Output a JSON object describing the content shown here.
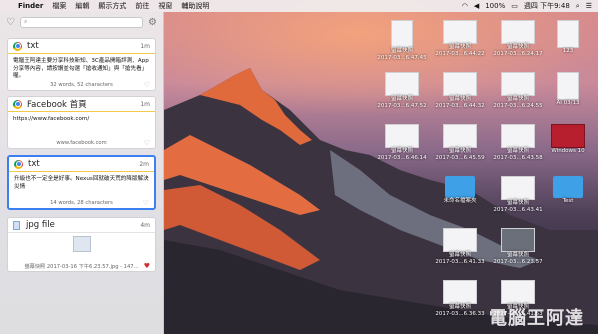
{
  "menubar": {
    "apple": "",
    "items": [
      "Finder",
      "檔案",
      "編輯",
      "顯示方式",
      "前往",
      "視窗",
      "輔助說明"
    ],
    "status": {
      "battery": "100%",
      "clock": "週四 下午9:48"
    }
  },
  "panel": {
    "search_placeholder": "",
    "clips": [
      {
        "title": "txt",
        "time": "1m",
        "body": "電腦王阿達主要分享科技新知、3C產品開箱評測、App分享等內容，請按讚並勾選「搶收通知」與「搶先看」喔。",
        "foot": "32 words, 52 characters"
      },
      {
        "title": "Facebook 首頁",
        "time": "1m",
        "body": "https://www.facebook.com/",
        "foot": "www.facebook.com"
      },
      {
        "title": "txt",
        "time": "2m",
        "body": "升級也不一定全是好事。Nexus回就破天荒的降版解決災情",
        "foot": "14 words, 28 characters"
      },
      {
        "title": "jpg file",
        "time": "4m",
        "body": "",
        "foot": "螢幕快照 2017-03-16 下午6.23.57.jpg - 147..."
      }
    ]
  },
  "desktop": {
    "icons": [
      {
        "label": "螢幕快照\n2017-03...6.47.45"
      },
      {
        "label": "螢幕快照\n2017-03...6.44.22"
      },
      {
        "label": "螢幕快照\n2017-03...6.24.17"
      },
      {
        "label": "123"
      },
      {
        "label": "螢幕快照\n2017-03...6.47.52"
      },
      {
        "label": "螢幕快照\n2017-03...6.44.32"
      },
      {
        "label": "螢幕快照\n2017-03...6.24.55"
      },
      {
        "label": "AI 03/13"
      },
      {
        "label": "螢幕快照\n2017-03...6.46.14"
      },
      {
        "label": "螢幕快照\n2017-03...6.45.59"
      },
      {
        "label": "螢幕快照\n2017-03...6.43.58"
      },
      {
        "label": "Windows 10"
      },
      {
        "label": "未命名檔案夾"
      },
      {
        "label": "螢幕快照\n2017-03...6.43.41"
      },
      {
        "label": "Test"
      },
      {
        "label": "螢幕快照\n2017-03...6.41.33"
      },
      {
        "label": "螢幕快照\n2017-03...6.23.57"
      },
      {
        "label": "螢幕快照\n2017-03...6.36.33"
      },
      {
        "label": "螢幕快照\n2017-03...6.41.53"
      }
    ]
  },
  "watermark": "電腦王阿達"
}
